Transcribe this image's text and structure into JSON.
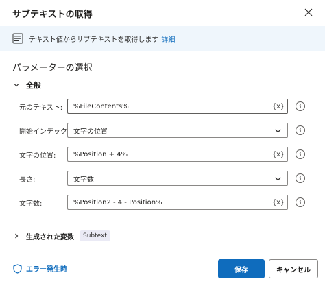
{
  "dialog": {
    "title": "サブテキストの取得",
    "close_icon": "close-icon"
  },
  "banner": {
    "icon": "text-abc-icon",
    "text": "テキスト値からサブテキストを取得します",
    "link": "詳細"
  },
  "parameters": {
    "section_title": "パラメーターの選択",
    "group_label": "全般",
    "rows": [
      {
        "label": "元のテキスト:",
        "value": "%FileContents%",
        "kind": "text",
        "badge": "{x}"
      },
      {
        "label": "開始インデックス:",
        "value": "文字の位置",
        "kind": "select"
      },
      {
        "label": "文字の位置:",
        "value": "%Position + 4%",
        "kind": "text",
        "badge": "{x}"
      },
      {
        "label": "長さ:",
        "value": "文字数",
        "kind": "select"
      },
      {
        "label": "文字数:",
        "value": "%Position2 - 4 - Position%",
        "kind": "text",
        "badge": "{x}"
      }
    ],
    "info_glyph": "i"
  },
  "output": {
    "label": "生成された変数",
    "variable": "Subtext"
  },
  "footer": {
    "error_label": "エラー発生時",
    "save_label": "保存",
    "cancel_label": "キャンセル"
  },
  "colors": {
    "accent": "#0f6cbd",
    "banner_bg": "#eff6fc",
    "chip_bg": "#eaeaf5",
    "border": "#8a8886"
  }
}
